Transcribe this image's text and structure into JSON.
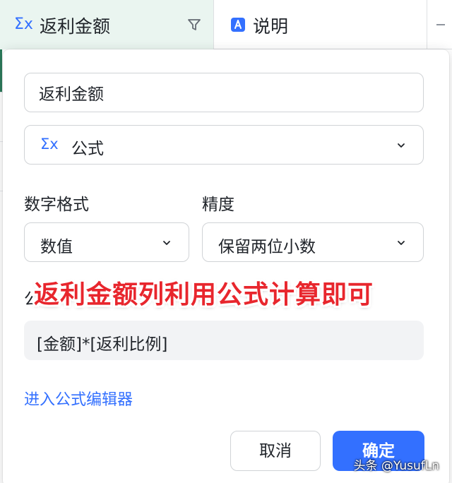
{
  "header": {
    "active_column": {
      "type_icon": "formula-sigma-icon",
      "type_symbol": "Σx",
      "title": "返利金额",
      "filter_icon": "filter-icon"
    },
    "second_column": {
      "type_icon": "text-type-icon",
      "title": "说明"
    }
  },
  "panel": {
    "name_value": "返利金额",
    "field_type": {
      "symbol": "Σx",
      "label": "公式"
    },
    "number_format": {
      "label": "数字格式",
      "value": "数值"
    },
    "precision": {
      "label": "精度",
      "value": "保留两位小数"
    },
    "formula": {
      "label": "公式",
      "value": "[金额]*[返利比例]"
    },
    "editor_link": "进入公式编辑器",
    "buttons": {
      "cancel": "取消",
      "ok": "确定"
    }
  },
  "annotation": "返利金额列利用公式计算即可",
  "watermark": "头条 @YusufLn",
  "colors": {
    "accent": "#3370ff",
    "active_column_bg": "#eaf5f0",
    "annotation": "#e8262d"
  }
}
